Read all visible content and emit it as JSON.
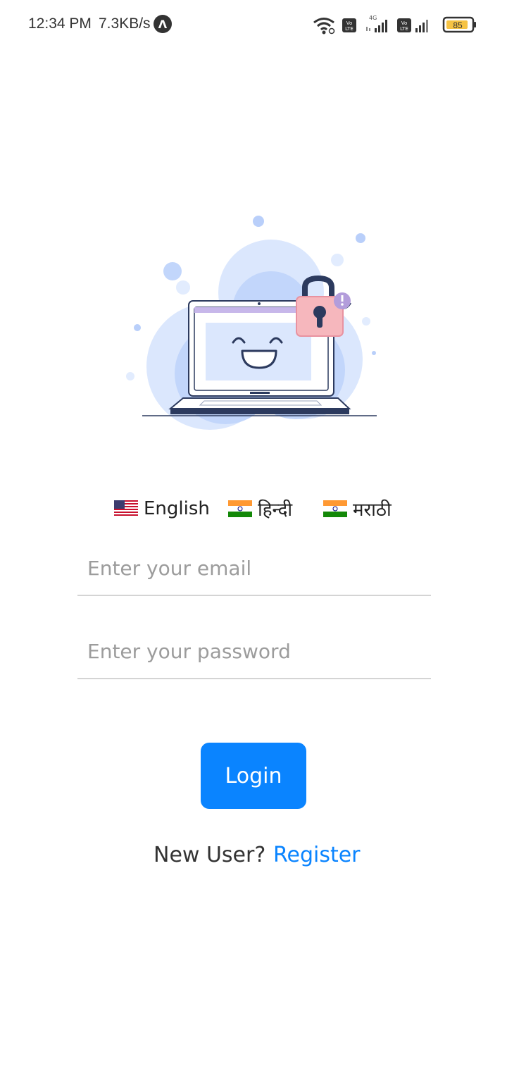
{
  "status_bar": {
    "time": "12:34 PM",
    "network_speed": "7.3KB/s",
    "app_indicator": "Λ",
    "network_type": "4G",
    "volte_label": "Vo LTE",
    "battery_level": "85",
    "icons": [
      "wifi-icon",
      "volte-icon",
      "signal-icon",
      "volte-icon",
      "signal-icon",
      "battery-icon"
    ]
  },
  "illustration": {
    "name": "laptop-lock-illustration",
    "colors": {
      "blob": "#dbe7fd",
      "blob_dark": "#c2d6fb",
      "lock_body": "#f6b7bd",
      "lock_shackle": "#2c3a5e",
      "alert": "#b39ddb",
      "laptop_outline": "#2c3a5e"
    }
  },
  "languages": [
    {
      "label": "English",
      "flag": "us-flag-icon"
    },
    {
      "label": "हिन्दी",
      "flag": "india-flag-icon"
    },
    {
      "label": "मराठी",
      "flag": "india-flag-icon"
    }
  ],
  "form": {
    "email": {
      "placeholder": "Enter your email",
      "value": ""
    },
    "password": {
      "placeholder": "Enter your password",
      "value": ""
    },
    "login_label": "Login"
  },
  "register": {
    "prompt": "New User?",
    "link_label": "Register"
  },
  "colors": {
    "accent": "#0a84ff",
    "input_border": "#d4d4d4",
    "placeholder": "#9c9c9c"
  }
}
